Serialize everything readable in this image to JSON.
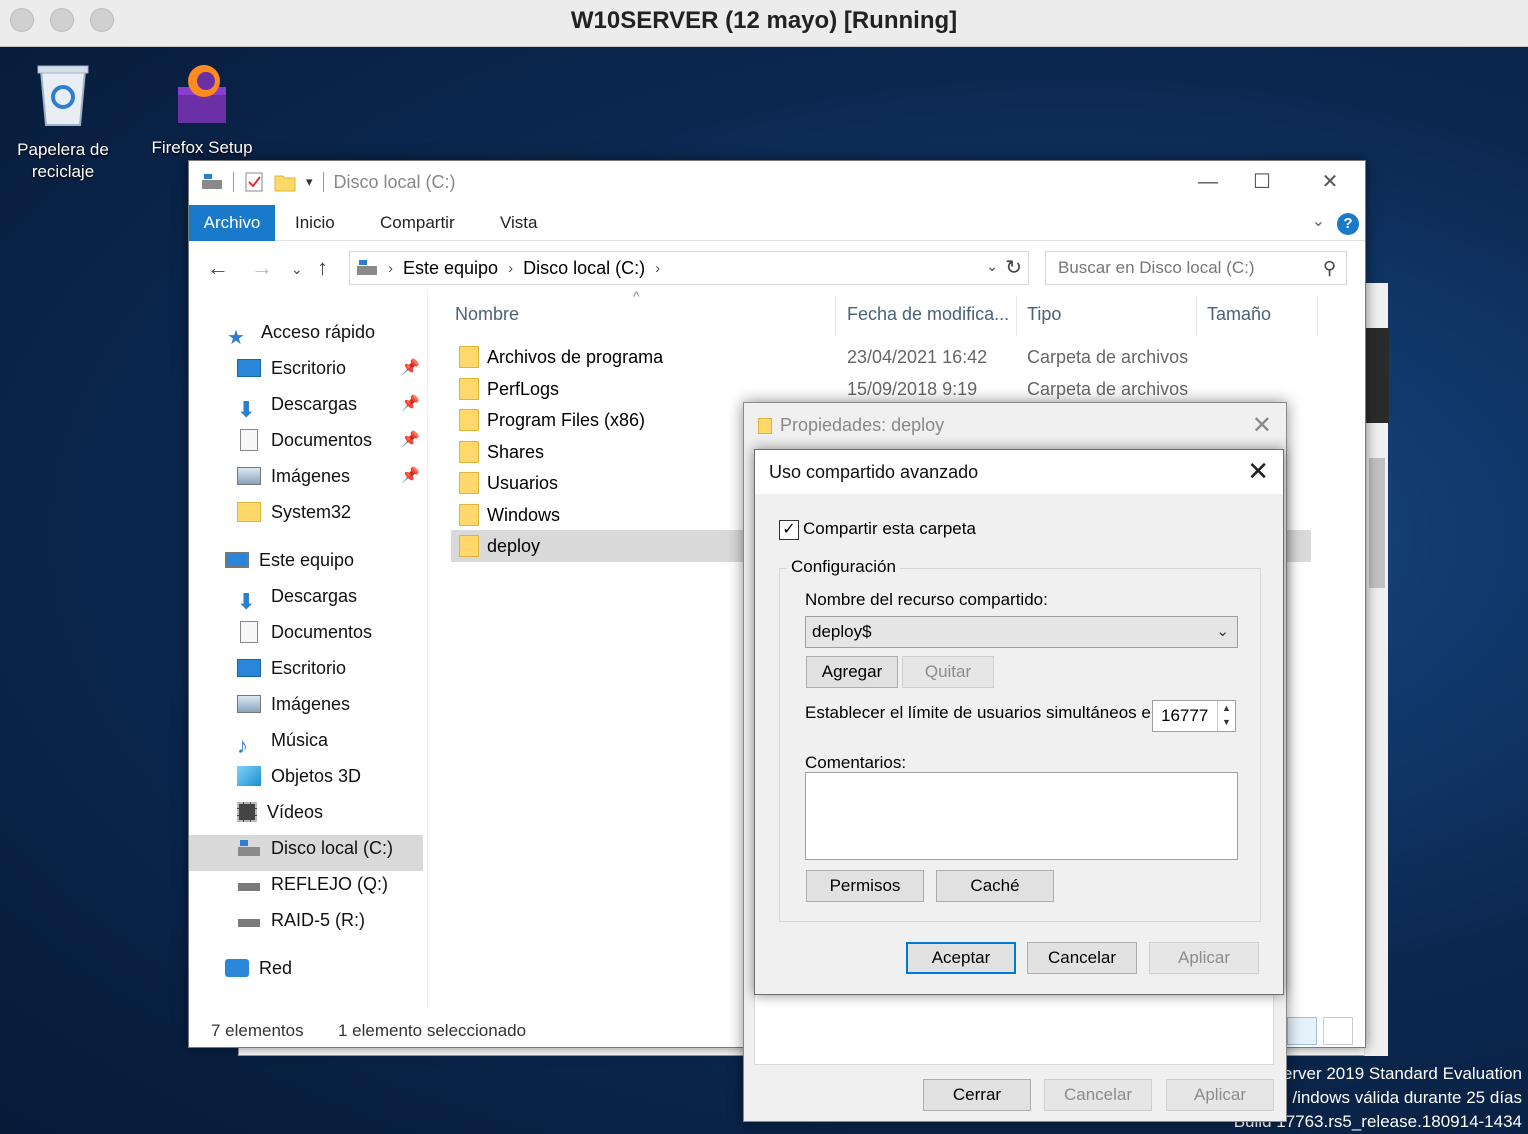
{
  "host": {
    "title": "W10SERVER (12 mayo) [Running]"
  },
  "desktop": {
    "icons": [
      {
        "label_line1": "Papelera de",
        "label_line2": "reciclaje"
      },
      {
        "label_line1": "Firefox Setup",
        "label_line2": ""
      }
    ],
    "watermark": {
      "line1": "erver 2019 Standard Evaluation",
      "line2": "/indows válida durante 25 días",
      "line3": "Build 17763.rs5_release.180914-1434"
    }
  },
  "explorer": {
    "title": "Disco local (C:)",
    "ribbon_tabs": [
      "Archivo",
      "Inicio",
      "Compartir",
      "Vista"
    ],
    "breadcrumb": [
      "Este equipo",
      "Disco local (C:)"
    ],
    "search_placeholder": "Buscar en Disco local (C:)",
    "nav": {
      "quick_access": "Acceso rápido",
      "quick_items": [
        "Escritorio",
        "Descargas",
        "Documentos",
        "Imágenes",
        "System32"
      ],
      "this_pc": "Este equipo",
      "pc_items": [
        "Descargas",
        "Documentos",
        "Escritorio",
        "Imágenes",
        "Música",
        "Objetos 3D",
        "Vídeos",
        "Disco local (C:)",
        "REFLEJO (Q:)",
        "RAID-5 (R:)"
      ],
      "network": "Red"
    },
    "columns": {
      "name": "Nombre",
      "date": "Fecha de modifica...",
      "type": "Tipo",
      "size": "Tamaño"
    },
    "files": [
      {
        "name": "Archivos de programa",
        "date": "23/04/2021 16:42",
        "type": "Carpeta de archivos"
      },
      {
        "name": "PerfLogs",
        "date": "15/09/2018 9:19",
        "type": "Carpeta de archivos"
      },
      {
        "name": "Program Files (x86)",
        "date": "",
        "type": ""
      },
      {
        "name": "Shares",
        "date": "",
        "type": ""
      },
      {
        "name": "Usuarios",
        "date": "",
        "type": ""
      },
      {
        "name": "Windows",
        "date": "",
        "type": ""
      },
      {
        "name": "deploy",
        "date": "",
        "type": ""
      }
    ],
    "status": {
      "count": "7 elementos",
      "selected": "1 elemento seleccionado"
    }
  },
  "properties": {
    "title": "Propiedades: deploy",
    "buttons": {
      "close": "Cerrar",
      "cancel": "Cancelar",
      "apply": "Aplicar"
    }
  },
  "advanced": {
    "title": "Uso compartido avanzado",
    "share_checkbox": "Compartir esta carpeta",
    "share_checked": true,
    "group": "Configuración",
    "share_name_label": "Nombre del recurso compartido:",
    "share_name": "deploy$",
    "add": "Agregar",
    "remove": "Quitar",
    "limit_label": "Establecer el límite de usuarios simultáneos en:",
    "limit_value": "16777",
    "comments_label": "Comentarios:",
    "permissions": "Permisos",
    "cache": "Caché",
    "ok": "Aceptar",
    "cancel": "Cancelar",
    "apply": "Aplicar"
  }
}
